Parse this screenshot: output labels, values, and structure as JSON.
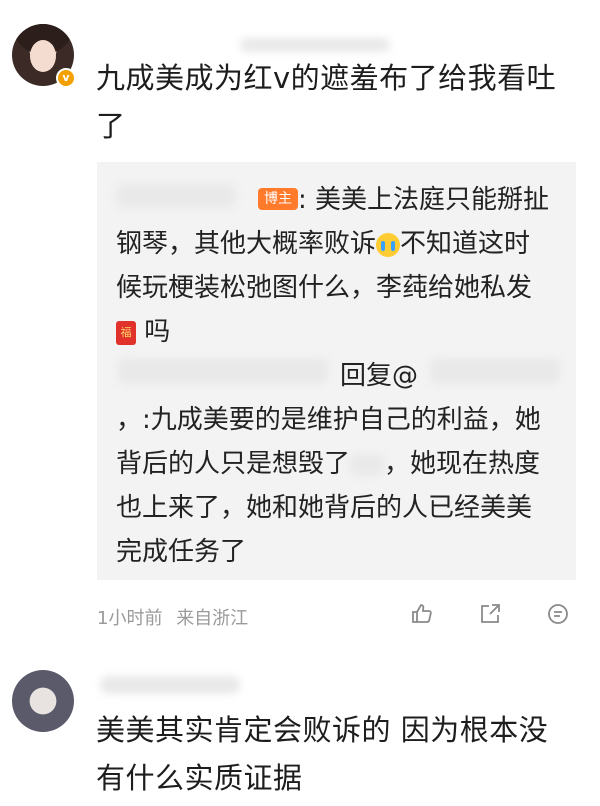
{
  "comment1": {
    "text": "九成美成为红v的遮羞布了给我看吐了",
    "verified_badge": "v"
  },
  "reply": {
    "host_tag": "博主",
    "line_a": ": 美美上法庭只能掰扯",
    "line_b_pre": "钢琴，其他大概率败诉",
    "line_b_post": "不知道这时",
    "line_c": "候玩梗装松弛图什么，李莼给她私发",
    "line_d": "吗",
    "redpacket_glyph": "福",
    "reply_label": "回复@",
    "body_1": "，:九成美要的是维护自己的利益，她",
    "body_2a": "背后的人只是想毁了",
    "body_2b": "，她现在热度",
    "body_3": "也上来了，她和她背后的人已经美美",
    "body_4": "完成任务了"
  },
  "meta": {
    "time": "1小时前",
    "location": "来自浙江"
  },
  "comment2": {
    "text_1": "美美其实肯定会败诉的 因为根本没",
    "text_2": "有什么实质证据"
  },
  "icons": [
    "like-icon",
    "share-icon",
    "comment-icon"
  ]
}
